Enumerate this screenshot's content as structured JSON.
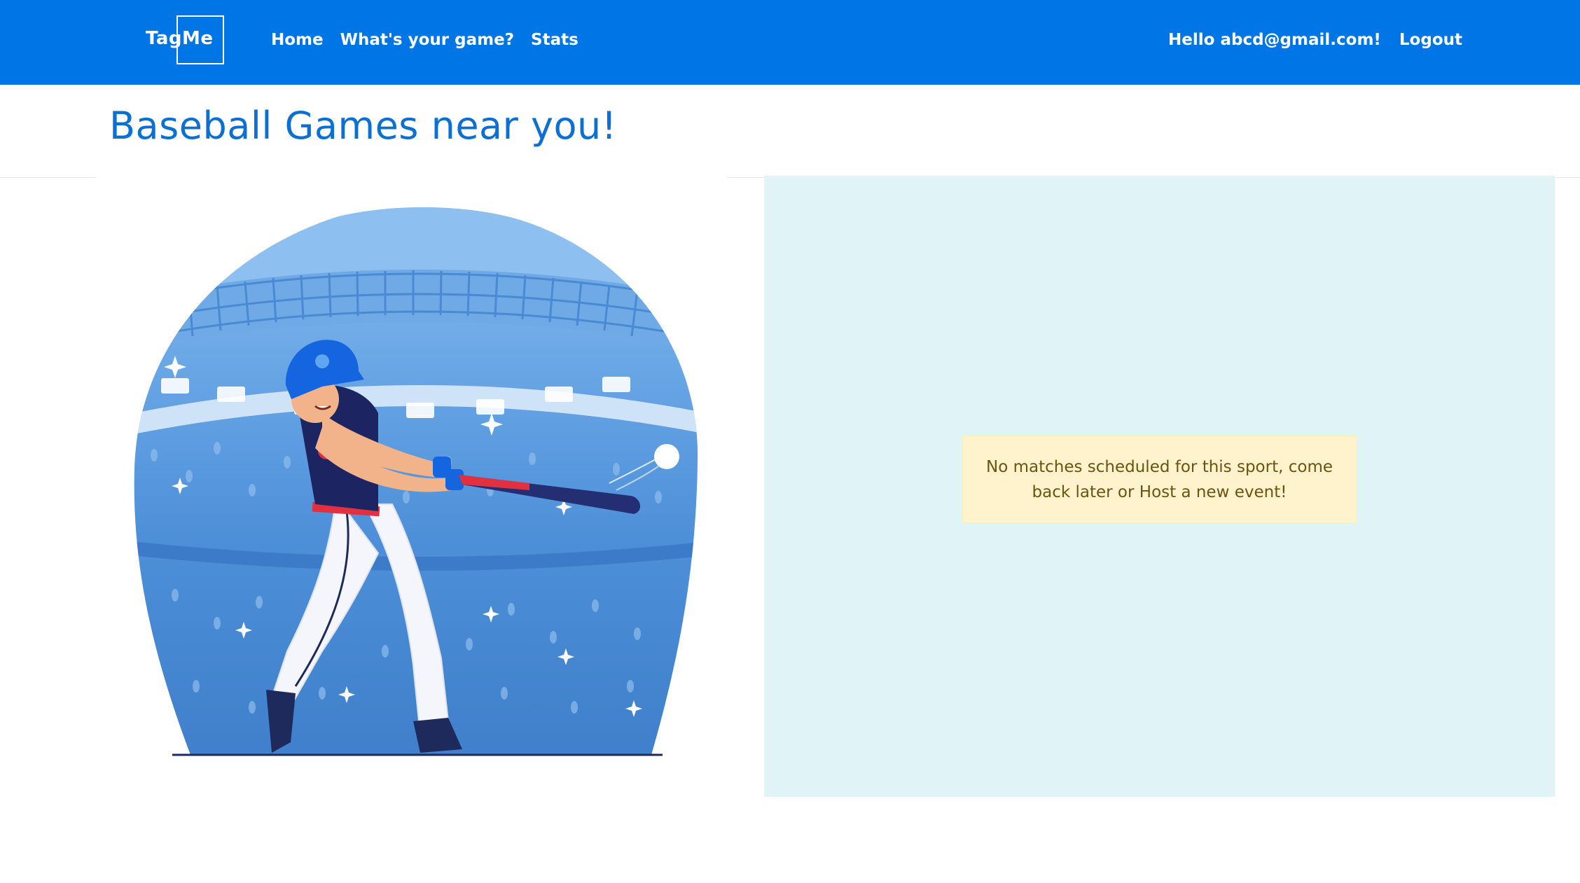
{
  "brand": {
    "logo_text": "TagMe"
  },
  "nav": {
    "links": [
      "Home",
      "What's your game?",
      "Stats"
    ],
    "greeting": "Hello abcd@gmail.com!",
    "logout": "Logout"
  },
  "page": {
    "title": "Baseball Games near you!"
  },
  "illustration": {
    "icon": "baseball-batter-illustration"
  },
  "panel": {
    "alert_text": "No matches scheduled for this sport, come back later or Host a new event!"
  },
  "colors": {
    "navbar": "#0075e6",
    "title": "#0c6fd3",
    "panel_bg": "#e0f4f8",
    "alert_bg": "#fff3cd",
    "alert_text": "#6b5410"
  }
}
